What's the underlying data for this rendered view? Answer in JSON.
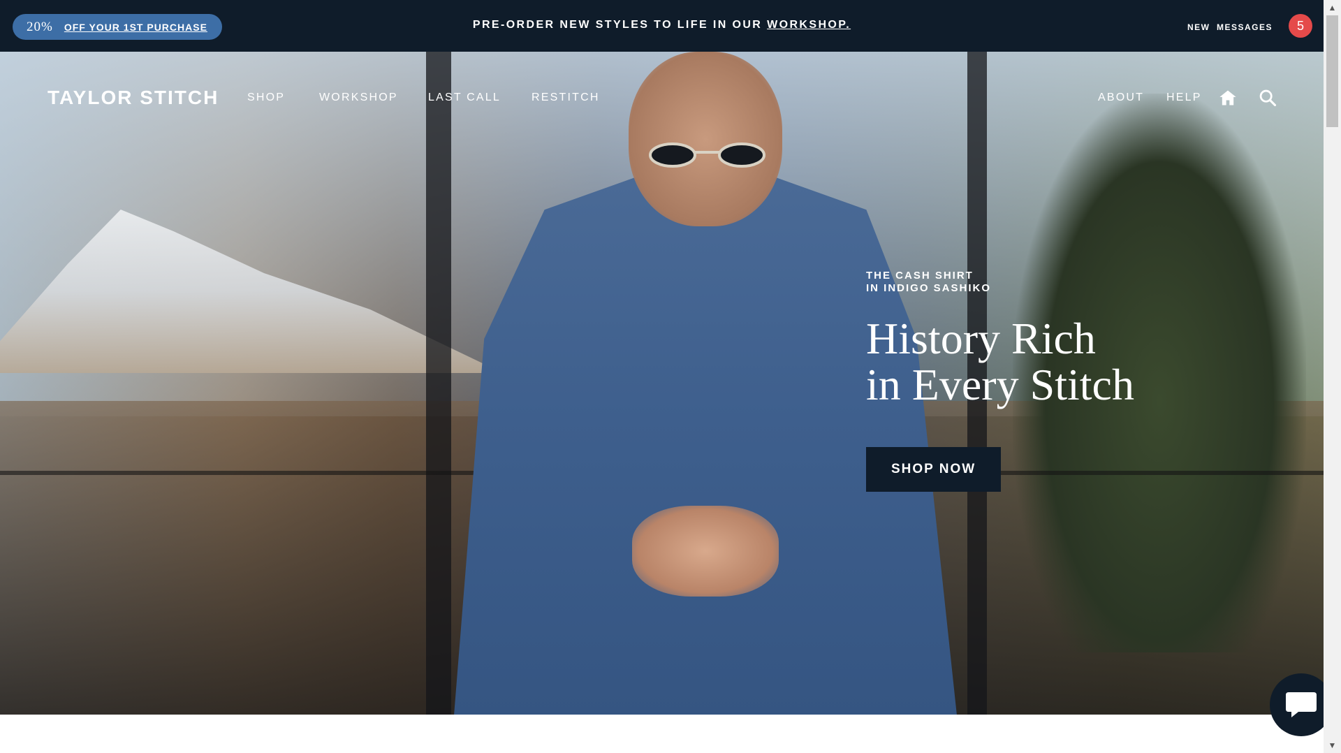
{
  "announcement": {
    "promo_percent": "20%",
    "promo_text": "OFF YOUR 1ST PURCHASE",
    "center_text": "PRE-ORDER NEW STYLES TO LIFE IN OUR ",
    "center_link": "WORKSHOP.",
    "messages_new": "NEW",
    "messages_label": "MESSAGES",
    "messages_count": "5"
  },
  "nav": {
    "logo": "TAYLOR STITCH",
    "left_items": [
      {
        "label": "SHOP"
      },
      {
        "label": "WORKSHOP"
      },
      {
        "label": "LAST CALL"
      },
      {
        "label": "RESTITCH"
      }
    ],
    "right_items": [
      {
        "label": "ABOUT"
      },
      {
        "label": "HELP"
      }
    ],
    "icons": [
      "home-icon",
      "search-icon"
    ]
  },
  "hero": {
    "eyebrow_line1": "THE CASH SHIRT",
    "eyebrow_line2": "IN INDIGO SASHIKO",
    "headline_line1": "History Rich",
    "headline_line2": "in Every Stitch",
    "cta": "SHOP NOW"
  },
  "carousel": {
    "slide_count": 5,
    "active_index": 2
  },
  "colors": {
    "navy": "#0f1c2a",
    "promo_blue": "#3d6ea6",
    "badge_red": "#e54a4a"
  }
}
